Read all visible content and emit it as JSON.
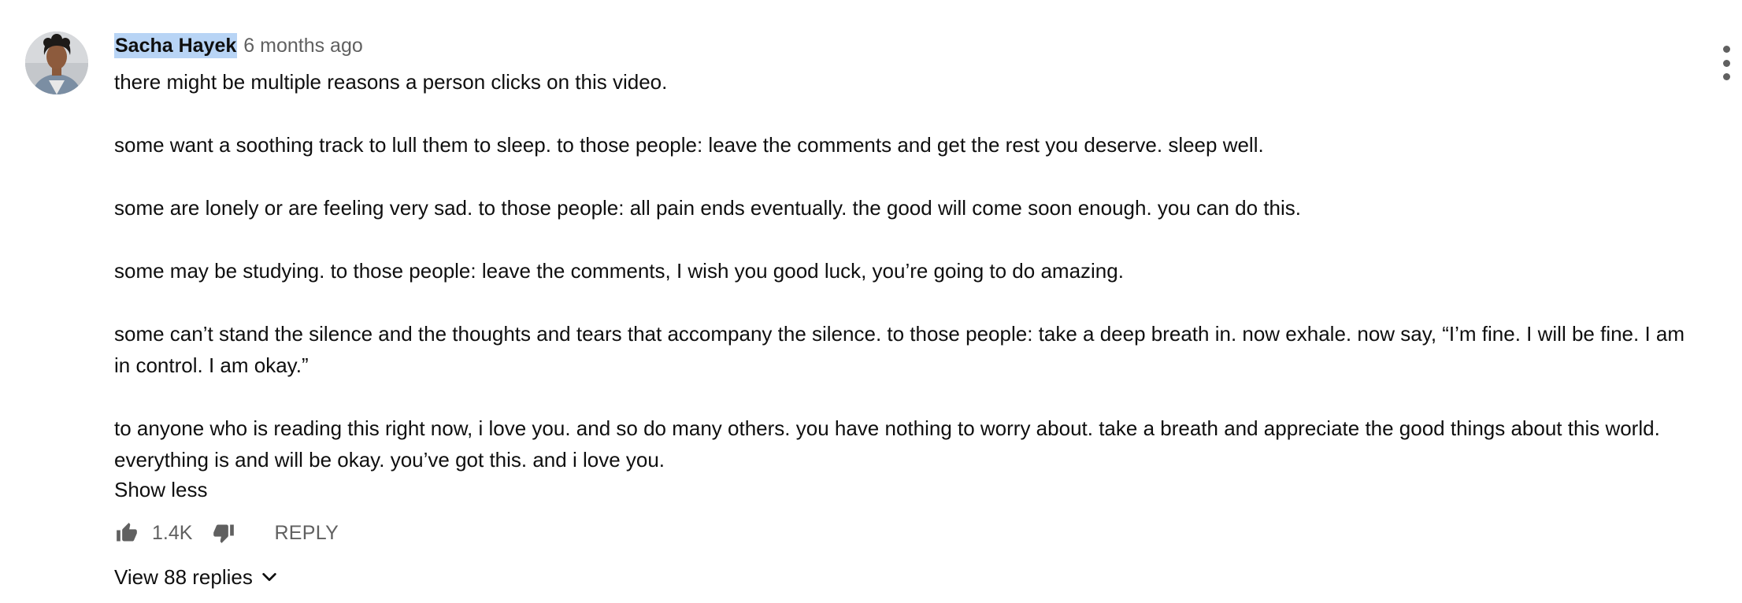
{
  "comment": {
    "author": "Sacha Hayek",
    "timestamp": "6 months ago",
    "avatar_icon": "user-avatar-photo",
    "menu_icon": "more-vertical-icon",
    "paragraphs": [
      "there might be multiple reasons a person clicks on this video.",
      "some want a soothing track to lull them to sleep. to those people: leave the comments and get the rest you deserve. sleep well.",
      "some are lonely or are feeling very sad. to those people: all pain ends eventually. the good will come soon enough. you can do this.",
      "some may be studying. to those people: leave the comments, I wish you good luck, you’re going to do amazing.",
      "some can’t stand the silence and the thoughts and tears that accompany the silence. to those people: take a deep breath in. now exhale. now say, “I’m fine. I will be fine. I am in control. I am okay.”",
      "to anyone who is reading this right now, i love you. and so do many others. you have nothing to worry about. take a breath and appreciate the good things about this world. everything is and will be okay. you’ve got this. and i love you."
    ],
    "show_less_label": "Show less",
    "like_icon": "thumbs-up-icon",
    "like_count": "1.4K",
    "dislike_icon": "thumbs-down-icon",
    "reply_label": "REPLY",
    "view_replies_label": "View 88 replies",
    "view_replies_icon": "chevron-down-icon",
    "colors": {
      "text": "#0f0f0f",
      "secondary_text": "#606060",
      "author_highlight": "#b8d4f5"
    }
  }
}
